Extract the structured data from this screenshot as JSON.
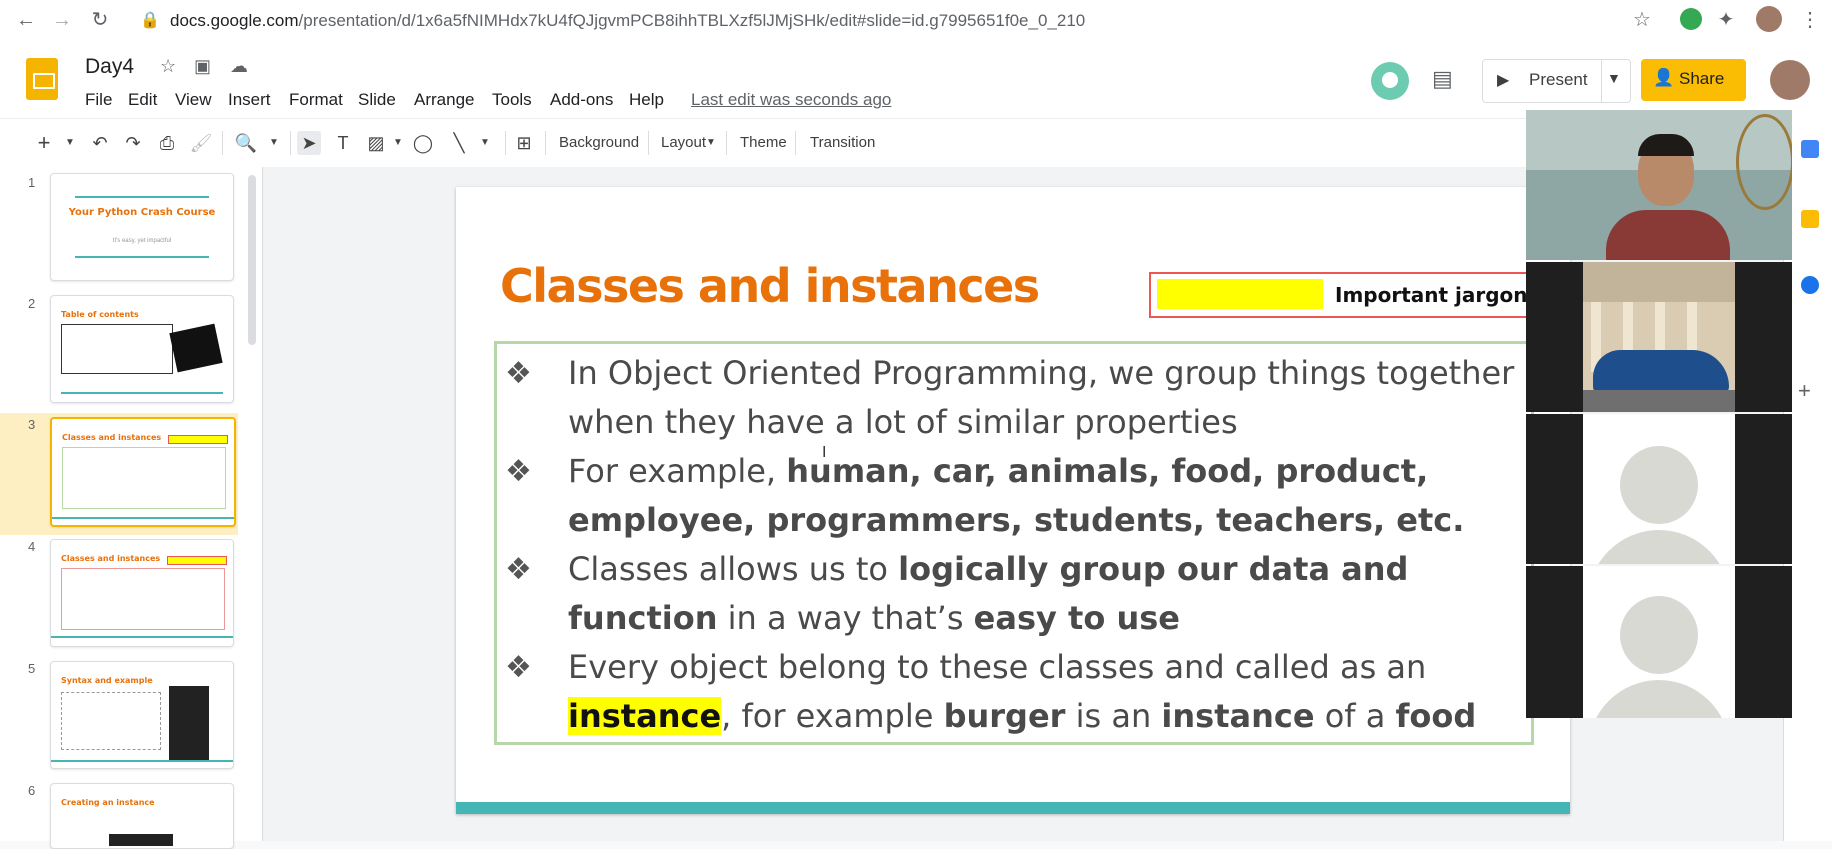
{
  "browser": {
    "url_domain": "docs.google.com",
    "url_path": "/presentation/d/1x6a5fNIMHdx7kU4fQJjgvmPCB8ihhTBLXzf5lJMjSHk/edit#slide=id.g7995651f0e_0_210"
  },
  "header": {
    "doc_title": "Day4",
    "menu": [
      "File",
      "Edit",
      "View",
      "Insert",
      "Format",
      "Slide",
      "Arrange",
      "Tools",
      "Add-ons",
      "Help"
    ],
    "last_edit": "Last edit was seconds ago",
    "present_label": "Present",
    "share_label": "Share"
  },
  "toolbar": {
    "background_label": "Background",
    "layout_label": "Layout",
    "theme_label": "Theme",
    "transition_label": "Transition"
  },
  "filmstrip": {
    "selected": 3,
    "slides": [
      {
        "num": "1",
        "title": "Your Python Crash Course",
        "subtitle": "It's easy, yet impactful"
      },
      {
        "num": "2",
        "title": "Table of contents"
      },
      {
        "num": "3",
        "title": "Classes and instances"
      },
      {
        "num": "4",
        "title": "Classes and instances"
      },
      {
        "num": "5",
        "title": "Syntax and example"
      },
      {
        "num": "6",
        "title": "Creating an instance"
      }
    ]
  },
  "slide": {
    "title": "Classes and instances",
    "jargon_label": "Important jargon!",
    "bullets": [
      {
        "parts": [
          {
            "t": "In Object Oriented Programming, we group things together when they have a lot of similar properties",
            "s": "n"
          }
        ]
      },
      {
        "parts": [
          {
            "t": "For example, ",
            "s": "n"
          },
          {
            "t": "human, car, animals, food, product, employee, programmers, students, teachers, etc.",
            "s": "b"
          }
        ]
      },
      {
        "parts": [
          {
            "t": "Classes allows us to ",
            "s": "n"
          },
          {
            "t": "logically group our data and function",
            "s": "b"
          },
          {
            "t": " in a way that’s ",
            "s": "n"
          },
          {
            "t": "easy to use",
            "s": "b"
          }
        ]
      },
      {
        "parts": [
          {
            "t": "Every object belong to these classes and called as an ",
            "s": "n"
          },
          {
            "t": "instance",
            "s": "h"
          },
          {
            "t": ", for example ",
            "s": "n"
          },
          {
            "t": "burger",
            "s": "b"
          },
          {
            "t": " is an ",
            "s": "n"
          },
          {
            "t": "instance",
            "s": "b"
          },
          {
            "t": " of a ",
            "s": "n"
          },
          {
            "t": "food",
            "s": "b"
          }
        ]
      }
    ]
  },
  "colors": {
    "title_orange": "#e8710a",
    "highlight_yellow": "#ffff00",
    "teal_bar": "#45b5b5",
    "content_border": "#b7d7a8",
    "share_yellow": "#fbbc04"
  },
  "icons": [
    "back-icon",
    "forward-icon",
    "reload-icon",
    "lock-icon",
    "star-icon",
    "extensions-icon",
    "comment-icon",
    "present-icon",
    "person-icon",
    "undo-icon",
    "redo-icon",
    "print-icon",
    "paint-format-icon",
    "zoom-icon",
    "cursor-icon",
    "textbox-icon",
    "image-icon",
    "shape-icon",
    "line-icon",
    "add-comment-icon"
  ]
}
